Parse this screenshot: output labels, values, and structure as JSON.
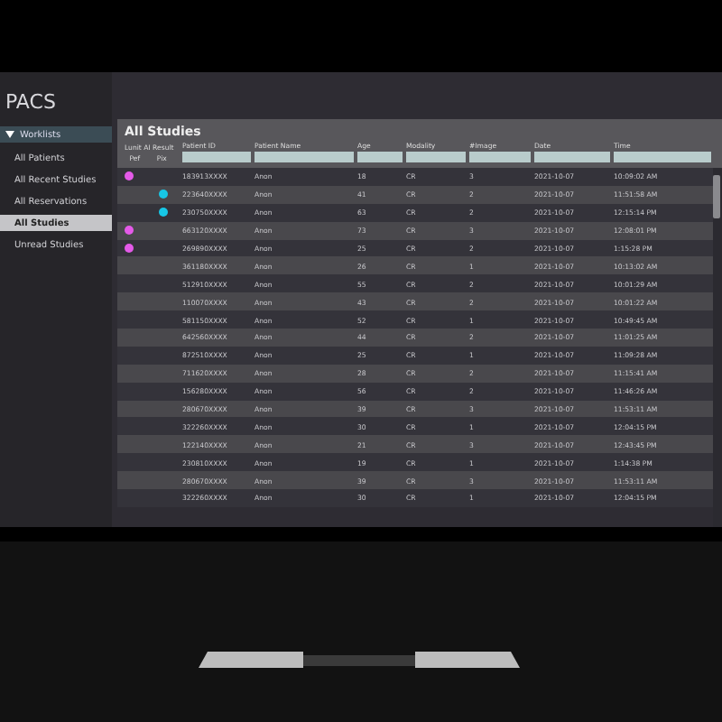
{
  "app": {
    "title": "PACS"
  },
  "sidebar": {
    "header": {
      "label": "Worklists",
      "expanded": true
    },
    "items": [
      {
        "label": "All Patients",
        "selected": false
      },
      {
        "label": "All Recent Studies",
        "selected": false
      },
      {
        "label": "All Reservations",
        "selected": false
      },
      {
        "label": "All Studies",
        "selected": true
      },
      {
        "label": "Unread Studies",
        "selected": false
      }
    ]
  },
  "panel": {
    "title": "All Studies",
    "flag_group": "Lunit AI Result",
    "flag_columns": [
      "Pef",
      "Pix"
    ],
    "columns": [
      "Patient ID",
      "Patient Name",
      "Age",
      "Modality",
      "#Image",
      "Date",
      "Time"
    ],
    "rows": [
      {
        "pef": true,
        "pix": false,
        "cells": [
          "183913XXXX",
          "Anon",
          "18",
          "CR",
          "3",
          "2021-10-07",
          "10:09:02 AM"
        ]
      },
      {
        "pef": false,
        "pix": true,
        "cells": [
          "223640XXXX",
          "Anon",
          "41",
          "CR",
          "2",
          "2021-10-07",
          "11:51:58 AM"
        ]
      },
      {
        "pef": false,
        "pix": true,
        "cells": [
          "230750XXXX",
          "Anon",
          "63",
          "CR",
          "2",
          "2021-10-07",
          "12:15:14 PM"
        ]
      },
      {
        "pef": true,
        "pix": false,
        "cells": [
          "663120XXXX",
          "Anon",
          "73",
          "CR",
          "3",
          "2021-10-07",
          "12:08:01 PM"
        ]
      },
      {
        "pef": true,
        "pix": false,
        "cells": [
          "269890XXXX",
          "Anon",
          "25",
          "CR",
          "2",
          "2021-10-07",
          "1:15:28 PM"
        ]
      },
      {
        "pef": false,
        "pix": false,
        "cells": [
          "361180XXXX",
          "Anon",
          "26",
          "CR",
          "1",
          "2021-10-07",
          "10:13:02 AM"
        ]
      },
      {
        "pef": false,
        "pix": false,
        "cells": [
          "512910XXXX",
          "Anon",
          "55",
          "CR",
          "2",
          "2021-10-07",
          "10:01:29 AM"
        ]
      },
      {
        "pef": false,
        "pix": false,
        "cells": [
          "110070XXXX",
          "Anon",
          "43",
          "CR",
          "2",
          "2021-10-07",
          "10:01:22 AM"
        ]
      },
      {
        "pef": false,
        "pix": false,
        "cells": [
          "581150XXXX",
          "Anon",
          "52",
          "CR",
          "1",
          "2021-10-07",
          "10:49:45 AM"
        ]
      },
      {
        "pef": false,
        "pix": false,
        "cells": [
          "642560XXXX",
          "Anon",
          "44",
          "CR",
          "2",
          "2021-10-07",
          "11:01:25 AM"
        ]
      },
      {
        "pef": false,
        "pix": false,
        "cells": [
          "872510XXXX",
          "Anon",
          "25",
          "CR",
          "1",
          "2021-10-07",
          "11:09:28 AM"
        ]
      },
      {
        "pef": false,
        "pix": false,
        "cells": [
          "711620XXXX",
          "Anon",
          "28",
          "CR",
          "2",
          "2021-10-07",
          "11:15:41 AM"
        ]
      },
      {
        "pef": false,
        "pix": false,
        "cells": [
          "156280XXXX",
          "Anon",
          "56",
          "CR",
          "2",
          "2021-10-07",
          "11:46:26 AM"
        ]
      },
      {
        "pef": false,
        "pix": false,
        "cells": [
          "280670XXXX",
          "Anon",
          "39",
          "CR",
          "3",
          "2021-10-07",
          "11:53:11 AM"
        ]
      },
      {
        "pef": false,
        "pix": false,
        "cells": [
          "322260XXXX",
          "Anon",
          "30",
          "CR",
          "1",
          "2021-10-07",
          "12:04:15 PM"
        ]
      },
      {
        "pef": false,
        "pix": false,
        "cells": [
          "122140XXXX",
          "Anon",
          "21",
          "CR",
          "3",
          "2021-10-07",
          "12:43:45 PM"
        ]
      },
      {
        "pef": false,
        "pix": false,
        "cells": [
          "230810XXXX",
          "Anon",
          "19",
          "CR",
          "1",
          "2021-10-07",
          "1:14:38 PM"
        ]
      },
      {
        "pef": false,
        "pix": false,
        "cells": [
          "280670XXXX",
          "Anon",
          "39",
          "CR",
          "3",
          "2021-10-07",
          "11:53:11 AM"
        ]
      },
      {
        "pef": false,
        "pix": false,
        "cells": [
          "322260XXXX",
          "Anon",
          "30",
          "CR",
          "1",
          "2021-10-07",
          "12:04:15 PM"
        ]
      }
    ]
  }
}
